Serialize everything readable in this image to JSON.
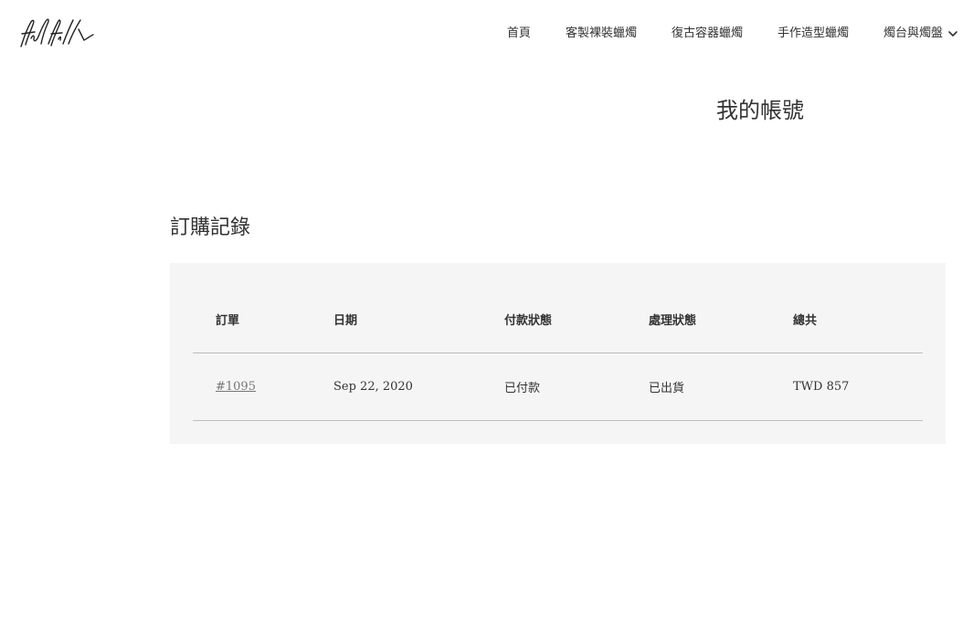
{
  "header": {
    "logo_text": "fulfill",
    "nav": [
      {
        "label": "首頁"
      },
      {
        "label": "客製裸裝蠟燭"
      },
      {
        "label": "復古容器蠟燭"
      },
      {
        "label": "手作造型蠟燭"
      },
      {
        "label": "燭台與燭盤",
        "has_dropdown": true
      }
    ]
  },
  "main": {
    "page_title": "我的帳號",
    "section_title": "訂購記錄",
    "orders_table": {
      "headers": [
        "訂單",
        "日期",
        "付款狀態",
        "處理狀態",
        "總共"
      ],
      "rows": [
        {
          "order": "#1095",
          "date": "Sep 22, 2020",
          "payment_status": "已付款",
          "fulfillment_status": "已出貨",
          "total": "TWD 857"
        }
      ]
    }
  },
  "colors": {
    "text": "#333333",
    "panel_bg": "#f5f5f5",
    "divider": "#bdbdbd",
    "link": "#777777"
  },
  "icons": {
    "dropdown": "chevron-down-icon"
  }
}
